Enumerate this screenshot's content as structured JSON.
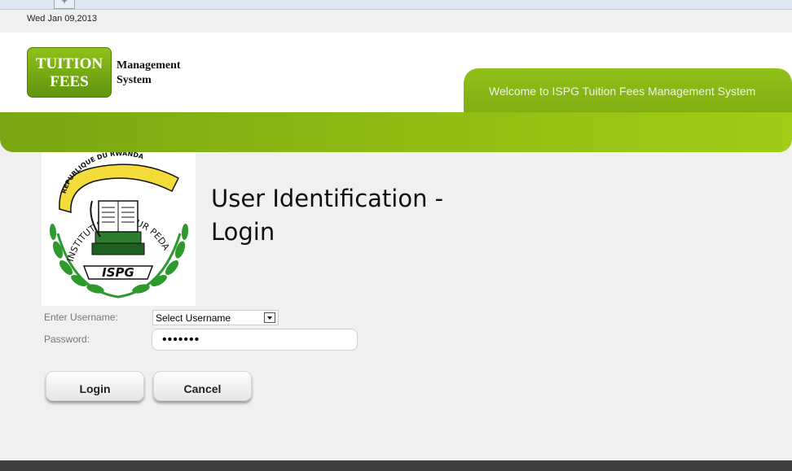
{
  "browser": {
    "new_tab_glyph": "+"
  },
  "date": "Wed Jan 09,2013",
  "logo": {
    "line1": "TUITION",
    "line2": "FEES",
    "sub1": "Management",
    "sub2": "System",
    "color": "#7ab013"
  },
  "welcome": "Welcome to ISPG Tuition Fees Management System",
  "emblem": {
    "top_banner": "REPUBLIQUE DU RWANDA",
    "ring_text": "INSTITUT SUPERIEUR PEDAGOGIQUE DE GITWE",
    "bottom_banner": "ISPG"
  },
  "page_title": {
    "line1": "User Identification -",
    "line2": "Login"
  },
  "form": {
    "username_label": "Enter Username:",
    "username_value": "Select Username",
    "password_label": "Password:",
    "password_value": "•••••••"
  },
  "buttons": {
    "login": "Login",
    "cancel": "Cancel"
  },
  "colors": {
    "accent_green": "#8dbb14",
    "footer": "#3d3d3d"
  }
}
